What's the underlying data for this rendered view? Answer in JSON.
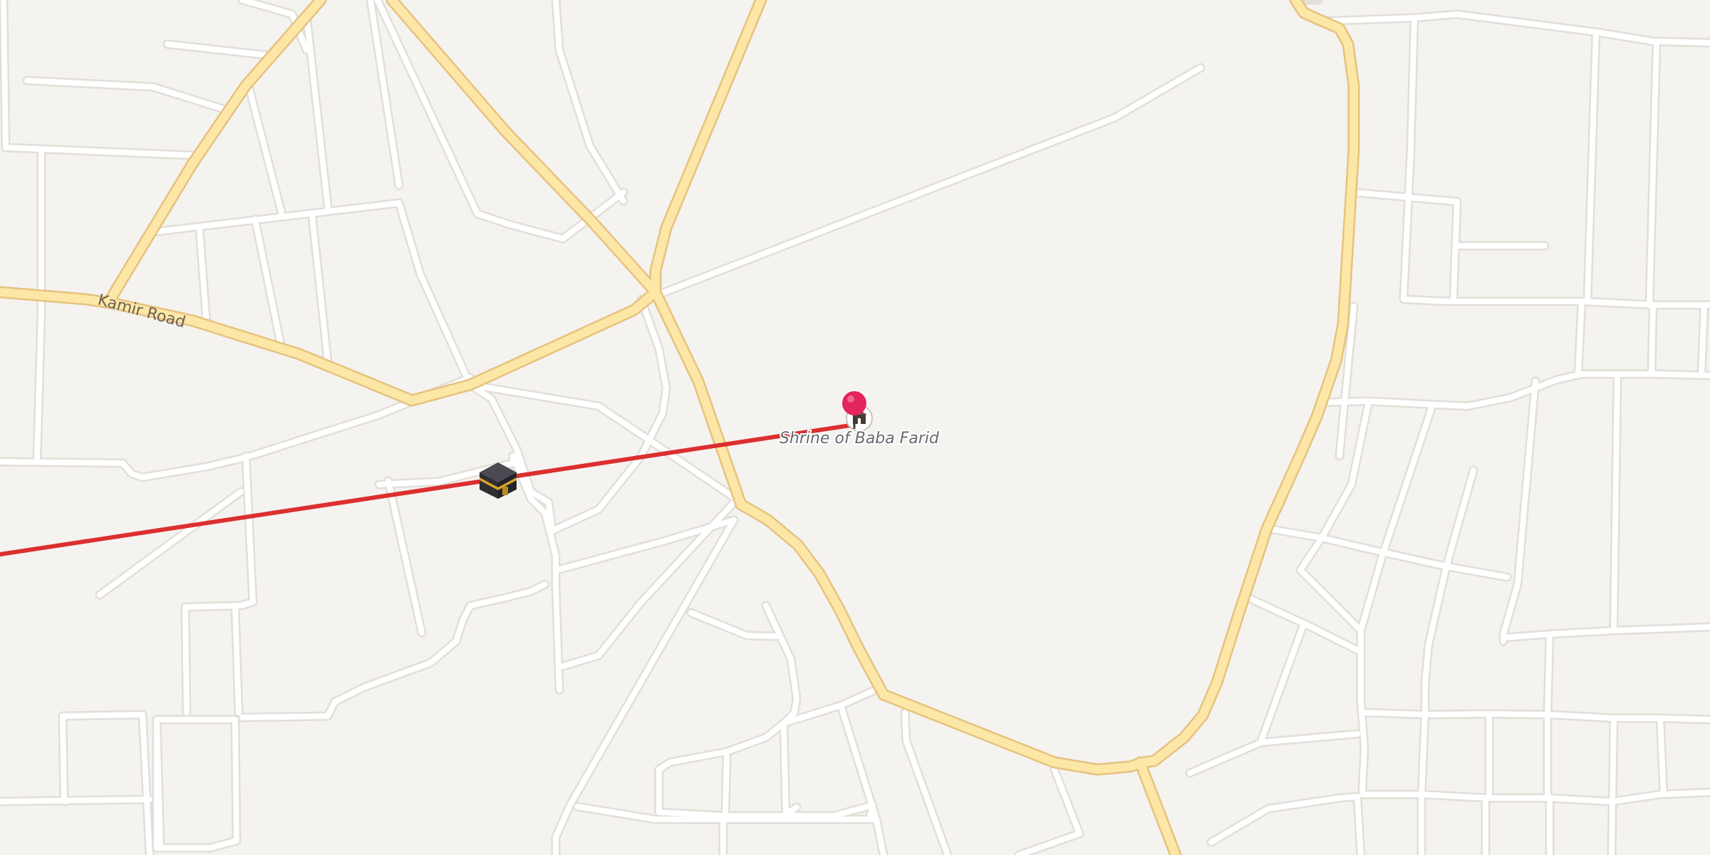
{
  "map": {
    "colors": {
      "land": "#f5f3f0",
      "minor_road": "#ffffff",
      "minor_road_casing": "#e2ded8",
      "major_road": "#fde7a6",
      "major_road_casing": "#e6c27f",
      "route_line": "#dc2f2f",
      "pin": "#e4245c"
    },
    "road_labels": [
      {
        "id": "kamir-road",
        "text": "Kamir Road"
      }
    ],
    "markers": [
      {
        "id": "shrine-pin",
        "icon": "map-pin-icon",
        "label": "Shrine of Baba Farid",
        "poi_icon": "shrine-icon"
      },
      {
        "id": "kaaba-marker",
        "icon": "kaaba-icon"
      }
    ],
    "route": {
      "id": "route-line",
      "color": "#dc2f2f"
    }
  }
}
